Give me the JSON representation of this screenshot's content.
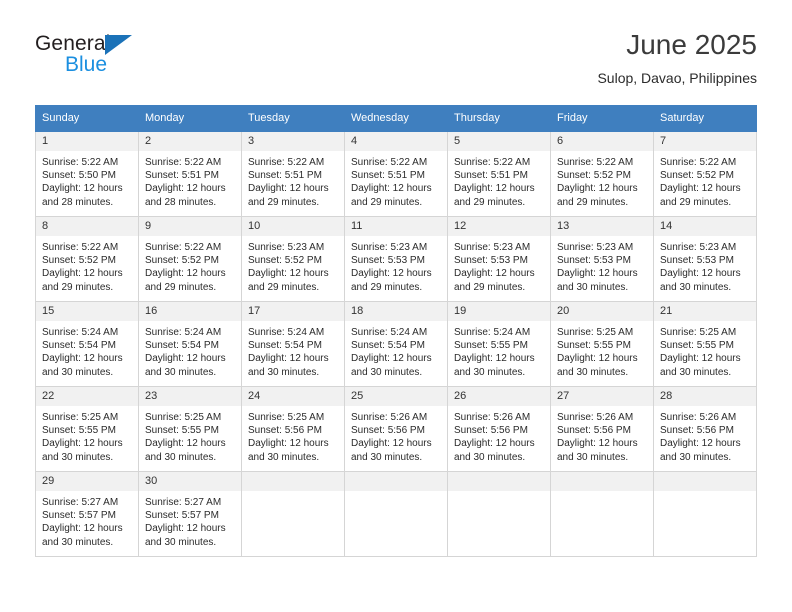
{
  "brand": {
    "name_top": "General",
    "name_bottom": "Blue",
    "triangle_color": "#1b72b8",
    "blue_text_color": "#1b8fe0"
  },
  "header": {
    "title": "June 2025",
    "subtitle": "Sulop, Davao, Philippines"
  },
  "theme": {
    "header_row_bg": "#3f7fbf",
    "header_row_text": "#ffffff",
    "daynum_bg": "#f1f1f1",
    "cell_border": "#d5d5d5"
  },
  "columns": [
    "Sunday",
    "Monday",
    "Tuesday",
    "Wednesday",
    "Thursday",
    "Friday",
    "Saturday"
  ],
  "weeks": [
    [
      {
        "day": "1",
        "sunrise": "Sunrise: 5:22 AM",
        "sunset": "Sunset: 5:50 PM",
        "daylight1": "Daylight: 12 hours",
        "daylight2": "and 28 minutes."
      },
      {
        "day": "2",
        "sunrise": "Sunrise: 5:22 AM",
        "sunset": "Sunset: 5:51 PM",
        "daylight1": "Daylight: 12 hours",
        "daylight2": "and 28 minutes."
      },
      {
        "day": "3",
        "sunrise": "Sunrise: 5:22 AM",
        "sunset": "Sunset: 5:51 PM",
        "daylight1": "Daylight: 12 hours",
        "daylight2": "and 29 minutes."
      },
      {
        "day": "4",
        "sunrise": "Sunrise: 5:22 AM",
        "sunset": "Sunset: 5:51 PM",
        "daylight1": "Daylight: 12 hours",
        "daylight2": "and 29 minutes."
      },
      {
        "day": "5",
        "sunrise": "Sunrise: 5:22 AM",
        "sunset": "Sunset: 5:51 PM",
        "daylight1": "Daylight: 12 hours",
        "daylight2": "and 29 minutes."
      },
      {
        "day": "6",
        "sunrise": "Sunrise: 5:22 AM",
        "sunset": "Sunset: 5:52 PM",
        "daylight1": "Daylight: 12 hours",
        "daylight2": "and 29 minutes."
      },
      {
        "day": "7",
        "sunrise": "Sunrise: 5:22 AM",
        "sunset": "Sunset: 5:52 PM",
        "daylight1": "Daylight: 12 hours",
        "daylight2": "and 29 minutes."
      }
    ],
    [
      {
        "day": "8",
        "sunrise": "Sunrise: 5:22 AM",
        "sunset": "Sunset: 5:52 PM",
        "daylight1": "Daylight: 12 hours",
        "daylight2": "and 29 minutes."
      },
      {
        "day": "9",
        "sunrise": "Sunrise: 5:22 AM",
        "sunset": "Sunset: 5:52 PM",
        "daylight1": "Daylight: 12 hours",
        "daylight2": "and 29 minutes."
      },
      {
        "day": "10",
        "sunrise": "Sunrise: 5:23 AM",
        "sunset": "Sunset: 5:52 PM",
        "daylight1": "Daylight: 12 hours",
        "daylight2": "and 29 minutes."
      },
      {
        "day": "11",
        "sunrise": "Sunrise: 5:23 AM",
        "sunset": "Sunset: 5:53 PM",
        "daylight1": "Daylight: 12 hours",
        "daylight2": "and 29 minutes."
      },
      {
        "day": "12",
        "sunrise": "Sunrise: 5:23 AM",
        "sunset": "Sunset: 5:53 PM",
        "daylight1": "Daylight: 12 hours",
        "daylight2": "and 29 minutes."
      },
      {
        "day": "13",
        "sunrise": "Sunrise: 5:23 AM",
        "sunset": "Sunset: 5:53 PM",
        "daylight1": "Daylight: 12 hours",
        "daylight2": "and 30 minutes."
      },
      {
        "day": "14",
        "sunrise": "Sunrise: 5:23 AM",
        "sunset": "Sunset: 5:53 PM",
        "daylight1": "Daylight: 12 hours",
        "daylight2": "and 30 minutes."
      }
    ],
    [
      {
        "day": "15",
        "sunrise": "Sunrise: 5:24 AM",
        "sunset": "Sunset: 5:54 PM",
        "daylight1": "Daylight: 12 hours",
        "daylight2": "and 30 minutes."
      },
      {
        "day": "16",
        "sunrise": "Sunrise: 5:24 AM",
        "sunset": "Sunset: 5:54 PM",
        "daylight1": "Daylight: 12 hours",
        "daylight2": "and 30 minutes."
      },
      {
        "day": "17",
        "sunrise": "Sunrise: 5:24 AM",
        "sunset": "Sunset: 5:54 PM",
        "daylight1": "Daylight: 12 hours",
        "daylight2": "and 30 minutes."
      },
      {
        "day": "18",
        "sunrise": "Sunrise: 5:24 AM",
        "sunset": "Sunset: 5:54 PM",
        "daylight1": "Daylight: 12 hours",
        "daylight2": "and 30 minutes."
      },
      {
        "day": "19",
        "sunrise": "Sunrise: 5:24 AM",
        "sunset": "Sunset: 5:55 PM",
        "daylight1": "Daylight: 12 hours",
        "daylight2": "and 30 minutes."
      },
      {
        "day": "20",
        "sunrise": "Sunrise: 5:25 AM",
        "sunset": "Sunset: 5:55 PM",
        "daylight1": "Daylight: 12 hours",
        "daylight2": "and 30 minutes."
      },
      {
        "day": "21",
        "sunrise": "Sunrise: 5:25 AM",
        "sunset": "Sunset: 5:55 PM",
        "daylight1": "Daylight: 12 hours",
        "daylight2": "and 30 minutes."
      }
    ],
    [
      {
        "day": "22",
        "sunrise": "Sunrise: 5:25 AM",
        "sunset": "Sunset: 5:55 PM",
        "daylight1": "Daylight: 12 hours",
        "daylight2": "and 30 minutes."
      },
      {
        "day": "23",
        "sunrise": "Sunrise: 5:25 AM",
        "sunset": "Sunset: 5:55 PM",
        "daylight1": "Daylight: 12 hours",
        "daylight2": "and 30 minutes."
      },
      {
        "day": "24",
        "sunrise": "Sunrise: 5:25 AM",
        "sunset": "Sunset: 5:56 PM",
        "daylight1": "Daylight: 12 hours",
        "daylight2": "and 30 minutes."
      },
      {
        "day": "25",
        "sunrise": "Sunrise: 5:26 AM",
        "sunset": "Sunset: 5:56 PM",
        "daylight1": "Daylight: 12 hours",
        "daylight2": "and 30 minutes."
      },
      {
        "day": "26",
        "sunrise": "Sunrise: 5:26 AM",
        "sunset": "Sunset: 5:56 PM",
        "daylight1": "Daylight: 12 hours",
        "daylight2": "and 30 minutes."
      },
      {
        "day": "27",
        "sunrise": "Sunrise: 5:26 AM",
        "sunset": "Sunset: 5:56 PM",
        "daylight1": "Daylight: 12 hours",
        "daylight2": "and 30 minutes."
      },
      {
        "day": "28",
        "sunrise": "Sunrise: 5:26 AM",
        "sunset": "Sunset: 5:56 PM",
        "daylight1": "Daylight: 12 hours",
        "daylight2": "and 30 minutes."
      }
    ],
    [
      {
        "day": "29",
        "sunrise": "Sunrise: 5:27 AM",
        "sunset": "Sunset: 5:57 PM",
        "daylight1": "Daylight: 12 hours",
        "daylight2": "and 30 minutes."
      },
      {
        "day": "30",
        "sunrise": "Sunrise: 5:27 AM",
        "sunset": "Sunset: 5:57 PM",
        "daylight1": "Daylight: 12 hours",
        "daylight2": "and 30 minutes."
      },
      {
        "day": "",
        "sunrise": "",
        "sunset": "",
        "daylight1": "",
        "daylight2": ""
      },
      {
        "day": "",
        "sunrise": "",
        "sunset": "",
        "daylight1": "",
        "daylight2": ""
      },
      {
        "day": "",
        "sunrise": "",
        "sunset": "",
        "daylight1": "",
        "daylight2": ""
      },
      {
        "day": "",
        "sunrise": "",
        "sunset": "",
        "daylight1": "",
        "daylight2": ""
      },
      {
        "day": "",
        "sunrise": "",
        "sunset": "",
        "daylight1": "",
        "daylight2": ""
      }
    ]
  ]
}
